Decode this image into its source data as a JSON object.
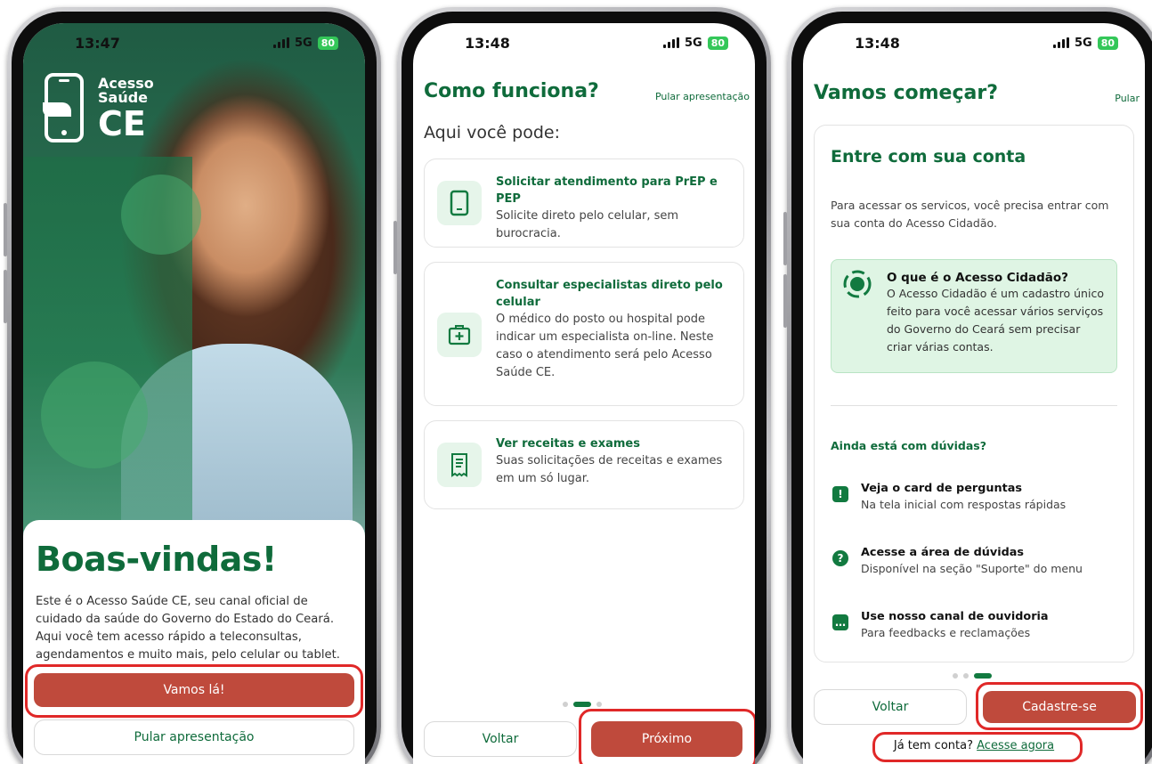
{
  "screen1": {
    "status": {
      "time": "13:47",
      "network": "5G",
      "battery": "80"
    },
    "logo": {
      "line1": "Acesso",
      "line2": "Saúde",
      "line3": "CE"
    },
    "title": "Boas-vindas!",
    "body": "Este é o Acesso Saúde CE, seu canal oficial de cuidado da saúde do Governo do Estado do Ceará. Aqui você tem acesso rápido a teleconsultas, agendamentos e muito mais, pelo celular ou tablet.",
    "primary_button": "Vamos lá!",
    "secondary_button": "Pular apresentação"
  },
  "screen2": {
    "status": {
      "time": "13:48",
      "network": "5G",
      "battery": "80"
    },
    "title": "Como funciona?",
    "skip": "Pular apresentação",
    "subtitle": "Aqui você pode:",
    "features": [
      {
        "icon": "phone-icon",
        "title": "Solicitar atendimento para PrEP e PEP",
        "desc": "Solicite direto pelo celular, sem burocracia."
      },
      {
        "icon": "medical-kit-icon",
        "title": "Consultar especialistas direto pelo celular",
        "desc": "O médico do posto ou hospital pode indicar um especialista on-line. Neste caso o atendimento será pelo Acesso Saúde CE."
      },
      {
        "icon": "receipt-icon",
        "title": "Ver receitas e exames",
        "desc": "Suas solicitações de receitas e exames em um só lugar."
      }
    ],
    "back_button": "Voltar",
    "next_button": "Próximo"
  },
  "screen3": {
    "status": {
      "time": "13:48",
      "network": "5G",
      "battery": "80"
    },
    "title": "Vamos começar?",
    "skip": "Pular",
    "card_title": "Entre com sua conta",
    "intro": "Para acessar os servicos, você precisa entrar com sua conta do Acesso Cidadão.",
    "info_title": "O que é o Acesso Cidadão?",
    "info_text": "O Acesso Cidadão é um cadastro único feito para você acessar vários serviços do Governo do Ceará sem precisar criar várias contas.",
    "help_title": "Ainda está com dúvidas?",
    "help_items": [
      {
        "icon": "alert-chat-icon",
        "title": "Veja o card de perguntas",
        "desc": "Na tela inicial com respostas rápidas"
      },
      {
        "icon": "question-icon",
        "title": "Acesse a área de dúvidas",
        "desc": "Disponível na seção \"Suporte\" do menu"
      },
      {
        "icon": "chat-icon",
        "title": "Use nosso canal de ouvidoria",
        "desc": "Para feedbacks e reclamações"
      }
    ],
    "back_button": "Voltar",
    "signup_button": "Cadastre-se",
    "login_prompt": "Já tem conta?",
    "login_link": "Acesse agora"
  },
  "colors": {
    "brand_green": "#0f6b3b",
    "action_red": "#bf4a3c",
    "highlight_red": "#e02828",
    "battery_green": "#34c759"
  }
}
